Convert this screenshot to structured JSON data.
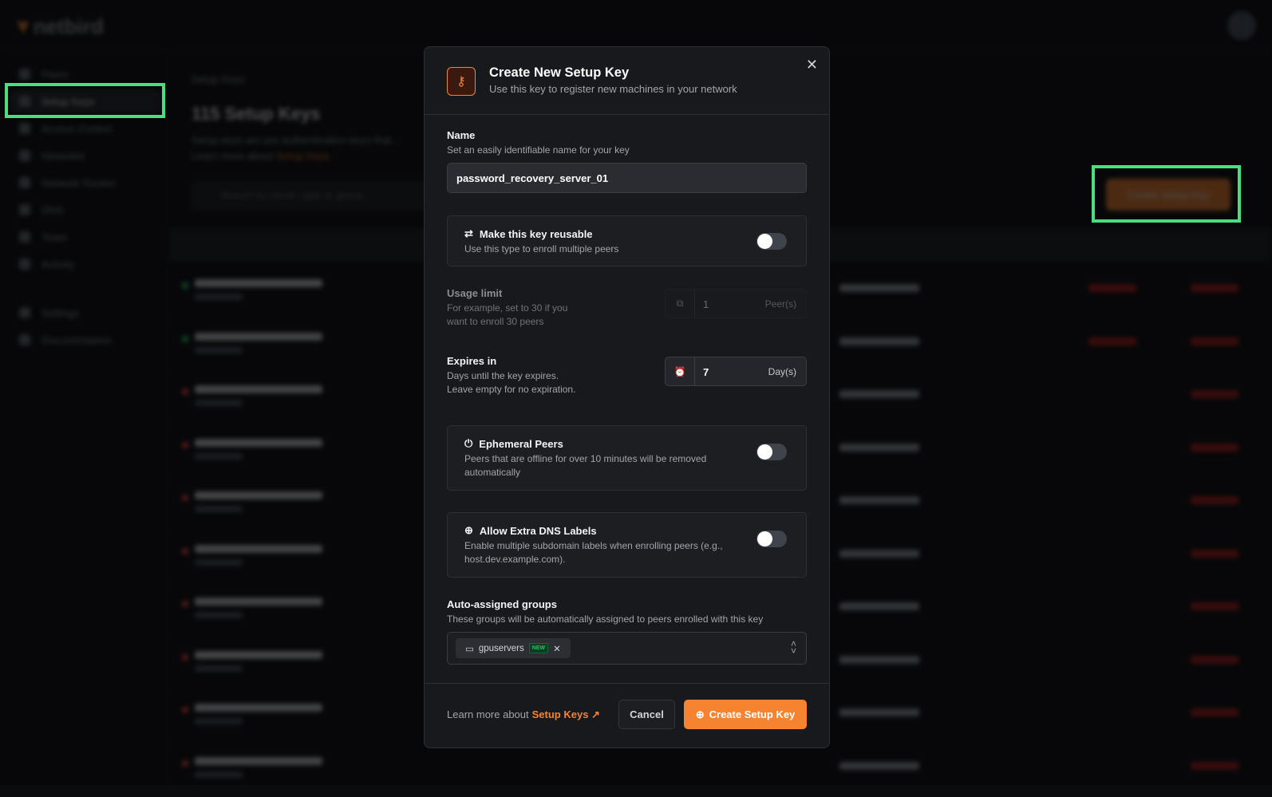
{
  "app": {
    "logo_text": "netbird",
    "brand_color": "#f68330"
  },
  "sidebar": {
    "items": [
      {
        "label": "Peers"
      },
      {
        "label": "Setup Keys",
        "active": true
      },
      {
        "label": "Access Control"
      },
      {
        "label": "Networks"
      },
      {
        "label": "Network Routes"
      },
      {
        "label": "DNS"
      },
      {
        "label": "Team"
      },
      {
        "label": "Activity"
      },
      {
        "label": "Settings"
      },
      {
        "label": "Documentation"
      }
    ]
  },
  "page": {
    "breadcrumb": "Setup Keys",
    "title": "115 Setup Keys",
    "description_line1": "Setup keys are pre-authentication keys that...",
    "description_learn": "Learn more about",
    "description_link": "Setup Keys",
    "search_placeholder": "Search by name, type or group...",
    "create_button": "Create Setup Key",
    "row_statuses": [
      "valid",
      "valid",
      "revoked",
      "revoked",
      "revoked",
      "revoked",
      "revoked",
      "revoked",
      "revoked",
      "revoked"
    ]
  },
  "modal": {
    "title": "Create New Setup Key",
    "subtitle": "Use this key to register new machines in your network",
    "name": {
      "label": "Name",
      "hint": "Set an easily identifiable name for your key",
      "value": "password_recovery_server_01"
    },
    "reusable": {
      "label": "Make this key reusable",
      "hint": "Use this type to enroll multiple peers",
      "enabled": false
    },
    "usage_limit": {
      "label": "Usage limit",
      "hint": "For example, set to 30 if you want to enroll 30 peers",
      "value": "1",
      "unit": "Peer(s)",
      "disabled": true
    },
    "expires": {
      "label": "Expires in",
      "hint_line1": "Days until the key expires.",
      "hint_line2": "Leave empty for no expiration.",
      "value": "7",
      "unit": "Day(s)"
    },
    "ephemeral": {
      "label": "Ephemeral Peers",
      "hint": "Peers that are offline for over 10 minutes will be removed automatically",
      "enabled": false
    },
    "dns_labels": {
      "label": "Allow Extra DNS Labels",
      "hint": "Enable multiple subdomain labels when enrolling peers (e.g., host.dev.example.com).",
      "enabled": false
    },
    "groups": {
      "label": "Auto-assigned groups",
      "hint": "These groups will be automatically assigned to peers enrolled with this key",
      "selected": [
        {
          "name": "gpuservers",
          "badge": "NEW"
        }
      ]
    },
    "footer": {
      "learn_text": "Learn more about",
      "learn_link": "Setup Keys",
      "cancel": "Cancel",
      "create": "Create Setup Key"
    }
  }
}
